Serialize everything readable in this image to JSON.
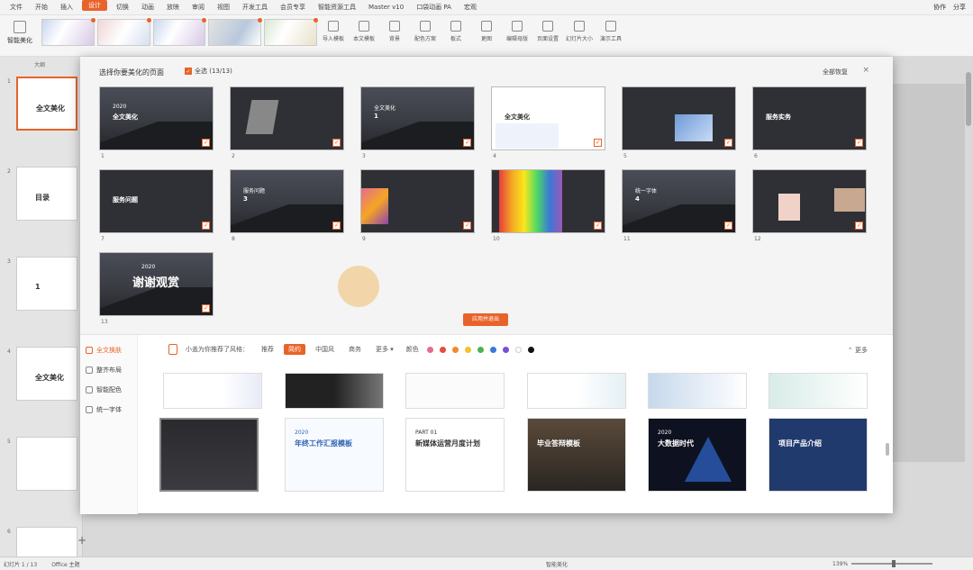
{
  "menu": {
    "file_label": "文件",
    "tabs": [
      "开始",
      "插入",
      "设计",
      "切换",
      "动画",
      "放映",
      "审阅",
      "视图",
      "开发工具",
      "会员专享",
      "智能资源工具",
      "Master v10",
      "口袋动画 PA",
      "宏观"
    ],
    "active_tab": "设计",
    "right": [
      "协作",
      "分享"
    ]
  },
  "ribbon": {
    "smart_beautify_label": "智能美化",
    "tools": [
      "导入模板",
      "本文模板",
      "背景",
      "配色方案",
      "板式",
      "更图",
      "编辑母版",
      "页面设置",
      "幻灯片大小",
      "演示工具"
    ]
  },
  "left_panel": {
    "tabs": [
      "",
      "大纲"
    ],
    "slides": [
      {
        "num": "1",
        "title": "全文美化"
      },
      {
        "num": "2",
        "title": "目录"
      },
      {
        "num": "3",
        "title": "1"
      },
      {
        "num": "4",
        "title": "全文美化"
      },
      {
        "num": "5",
        "title": ""
      },
      {
        "num": "6",
        "title": ""
      }
    ],
    "add_label": "+"
  },
  "modal": {
    "title": "选择你要美化的页面",
    "select_all": "全选 (13/13)",
    "restore": "全部恢复",
    "close": "×",
    "apply_button": "应用并退出",
    "slides": [
      {
        "num": "1",
        "caption": "全文美化",
        "sub": "2020"
      },
      {
        "num": "2",
        "caption": "",
        "sub": ""
      },
      {
        "num": "3",
        "caption": "1",
        "sub": "全文美化"
      },
      {
        "num": "4",
        "caption": "全文美化",
        "sub": ""
      },
      {
        "num": "5",
        "caption": "",
        "sub": ""
      },
      {
        "num": "6",
        "caption": "服务实务",
        "sub": ""
      },
      {
        "num": "7",
        "caption": "服务问题",
        "sub": ""
      },
      {
        "num": "8",
        "caption": "3",
        "sub": "服务问题"
      },
      {
        "num": "9",
        "caption": "",
        "sub": ""
      },
      {
        "num": "10",
        "caption": "",
        "sub": ""
      },
      {
        "num": "11",
        "caption": "4",
        "sub": "统一字体"
      },
      {
        "num": "12",
        "caption": "",
        "sub": ""
      },
      {
        "num": "13",
        "caption": "谢谢观赏",
        "sub": "2020"
      }
    ],
    "sidebar": [
      {
        "label": "全文换肤",
        "icon": "palette-icon",
        "active": true
      },
      {
        "label": "整齐布局",
        "icon": "layout-icon",
        "active": false
      },
      {
        "label": "智能配色",
        "icon": "color-icon",
        "active": false
      },
      {
        "label": "统一字体",
        "icon": "font-icon",
        "active": false
      }
    ],
    "filter": {
      "hint": "小盖为你推荐了风格：",
      "tags": [
        "推荐",
        "简约",
        "中国风",
        "商务",
        "更多 ▾"
      ],
      "active_tag": "简约",
      "color_label": "颜色",
      "colors": [
        "#e36b8f",
        "#e64b3c",
        "#f08a2c",
        "#f2c230",
        "#4cb34c",
        "#3b78d8",
        "#7b4ed8",
        "#ffffff",
        "#111111"
      ],
      "more": "⌃ 更多"
    },
    "templates_row2": [
      {
        "title": "",
        "sub": ""
      },
      {
        "title": "年终工作汇报模板",
        "sub": "2020"
      },
      {
        "title": "新媒体运营月度计划",
        "sub": "PART 01"
      },
      {
        "title": "毕业答辩模板",
        "sub": ""
      },
      {
        "title": "大数据时代",
        "sub": "2020"
      },
      {
        "title": "项目产品介绍",
        "sub": ""
      }
    ]
  },
  "status": {
    "slide_pos": "幻灯片 1 / 13",
    "theme": "Office 主题",
    "beautify": "智能美化",
    "zoom": "139%"
  }
}
